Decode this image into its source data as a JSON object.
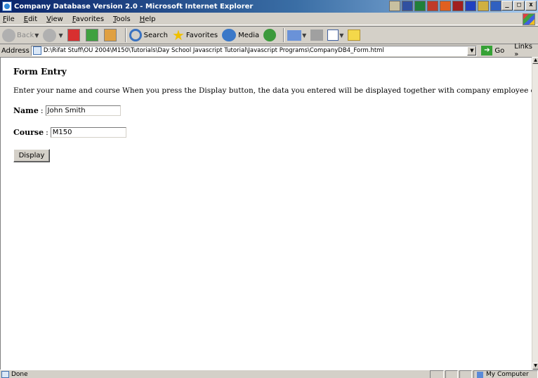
{
  "window": {
    "title": "Company Database Version 2.0 - Microsoft Internet Explorer",
    "minimize": "_",
    "restore": "□",
    "close": "x"
  },
  "menu": {
    "items": [
      "File",
      "Edit",
      "View",
      "Favorites",
      "Tools",
      "Help"
    ]
  },
  "toolbar": {
    "back_label": "Back",
    "search_label": "Search",
    "favorites_label": "Favorites",
    "media_label": "Media"
  },
  "address": {
    "label": "Address",
    "value": "D:\\Rifat Stuff\\OU 2004\\M150\\Tutorials\\Day School Javascript Tutorial\\Javascript Programs\\CompanyDB4_Form.html",
    "go_label": "Go",
    "links_label": "Links »"
  },
  "page": {
    "heading": "Form Entry",
    "intro": "Enter your name and course When you press the Display button, the data you entered will be displayed together with company employee details.",
    "name_label": "Name",
    "name_value": "John Smith",
    "course_label": "Course",
    "course_value": "M150",
    "display_button": "Display",
    "colon": ":"
  },
  "status": {
    "text": "Done",
    "zone": "My Computer"
  },
  "colors": {
    "titlebar_start": "#0a246a",
    "titlebar_end": "#a6caf0",
    "chrome": "#d4d0c8"
  }
}
